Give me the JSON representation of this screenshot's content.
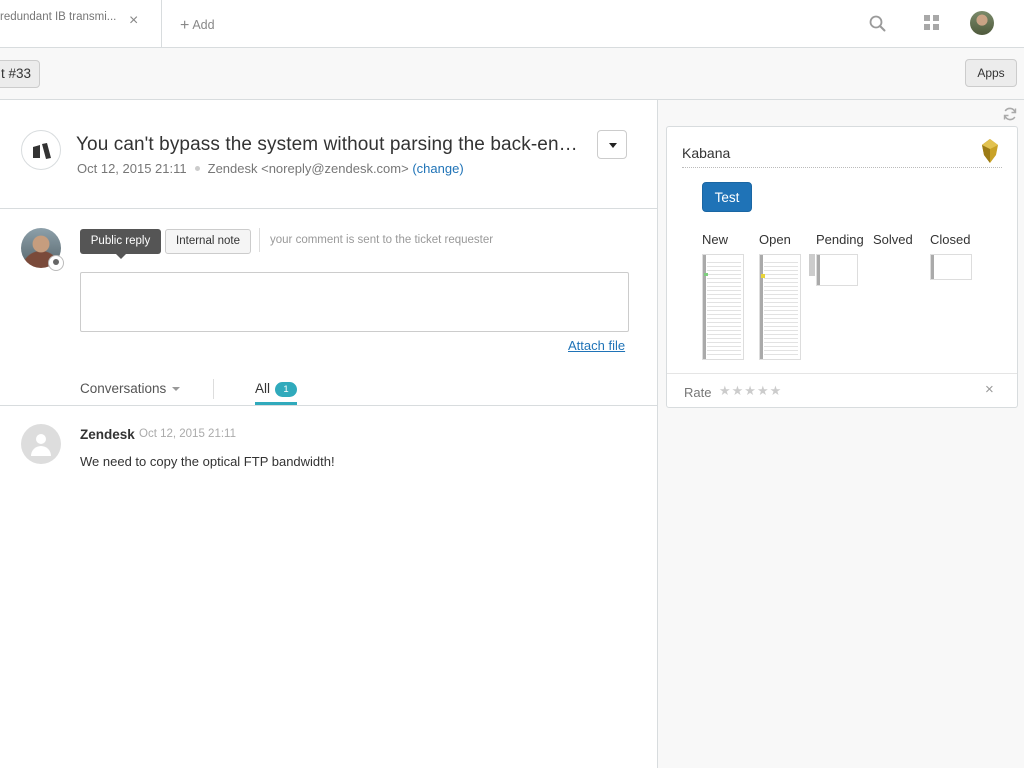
{
  "topbar": {
    "tab_title": "redundant IB transmi...",
    "tab_close": "×",
    "add_plus": "+",
    "add_label": "Add",
    "icons": [
      "search-icon",
      "apps-grid-icon",
      "user-avatar"
    ]
  },
  "subbar": {
    "ticket_label": "t #33",
    "apps_label": "Apps"
  },
  "ticket": {
    "title": "You can't bypass the system without parsing the back-end ADP alarm!",
    "date": "Oct 12, 2015 21:11",
    "requester": "Zendesk <noreply@zendesk.com>",
    "change_label": "(change)"
  },
  "reply": {
    "public_reply_label": "Public reply",
    "internal_note_label": "Internal note",
    "hint": "your comment is sent to the ticket requester",
    "comment_value": "",
    "attach_label": "Attach file"
  },
  "filters": {
    "conversations_label": "Conversations",
    "all_label": "All",
    "all_count": "1"
  },
  "events": [
    {
      "author": "Zendesk",
      "time": "Oct 12, 2015 21:11",
      "body": "We need to copy the optical FTP bandwidth!"
    }
  ],
  "app": {
    "title": "Kabana",
    "test_label": "Test",
    "columns": [
      "New",
      "Open",
      "Pending",
      "Solved",
      "Closed"
    ],
    "rate_label": "Rate",
    "rate_stars": "★★★★★",
    "rate_close": "×"
  },
  "colors": {
    "accent": "#1f73b7",
    "badge": "#30aabc"
  }
}
